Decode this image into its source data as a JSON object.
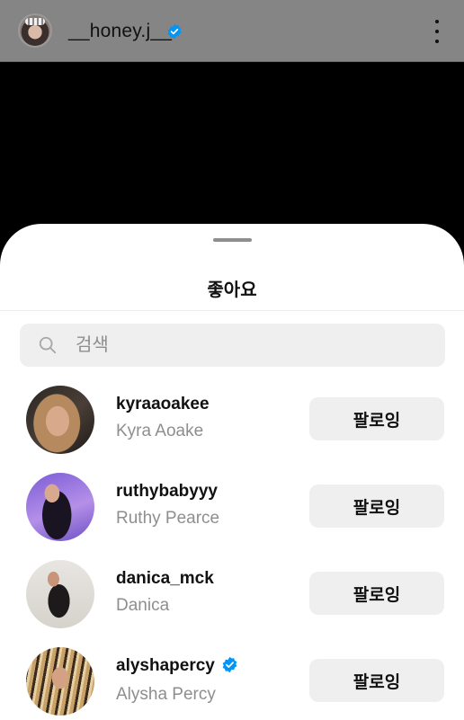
{
  "header": {
    "username": "__honey.j__",
    "verified": true
  },
  "sheet": {
    "title": "좋아요",
    "search": {
      "placeholder": "검색",
      "value": ""
    }
  },
  "likers": [
    {
      "username": "kyraaoakee",
      "full_name": "Kyra Aoake",
      "verified": false,
      "button_label": "팔로잉"
    },
    {
      "username": "ruthybabyyy",
      "full_name": "Ruthy Pearce",
      "verified": false,
      "button_label": "팔로잉"
    },
    {
      "username": "danica_mck",
      "full_name": "Danica",
      "verified": false,
      "button_label": "팔로잉"
    },
    {
      "username": "alyshapercy",
      "full_name": "Alysha Percy",
      "verified": true,
      "button_label": "팔로잉"
    }
  ],
  "colors": {
    "verified_badge": "#0095f6",
    "button_bg": "#efefef",
    "secondary_text": "#8e8e8e"
  }
}
